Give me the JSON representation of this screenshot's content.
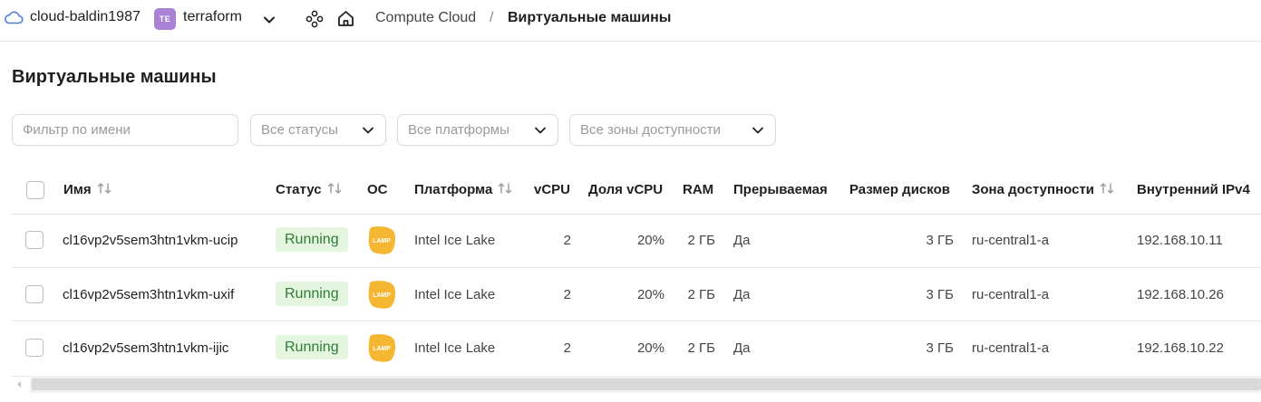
{
  "topbar": {
    "cloud_name": "cloud-baldin1987",
    "folder_badge": "TE",
    "folder_name": "terraform",
    "breadcrumb_service": "Compute Cloud",
    "breadcrumb_sep": "/",
    "breadcrumb_current": "Виртуальные машины",
    "accent_color": "#4a7fe0",
    "folder_badge_color": "#a982d6",
    "icons": [
      "cloud-icon",
      "chevron-down-icon",
      "services-icon",
      "home-icon"
    ]
  },
  "page": {
    "title": "Виртуальные машины"
  },
  "filters": {
    "name_placeholder": "Фильтр по имени",
    "status": "Все статусы",
    "platform": "Все платформы",
    "zone": "Все зоны доступности"
  },
  "table": {
    "columns": {
      "name": "Имя",
      "status": "Статус",
      "os": "ОС",
      "platform": "Платформа",
      "vcpu": "vCPU",
      "vcpu_share": "Доля vCPU",
      "ram": "RAM",
      "preemptible": "Прерываемая",
      "disk_size": "Размер дисков",
      "zone": "Зона доступности",
      "ipv4": "Внутренний IPv4"
    },
    "rows": [
      {
        "name": "cl16vp2v5sem3htn1vkm-ucip",
        "status": "Running",
        "os": "LAMP",
        "platform": "Intel Ice Lake",
        "vcpu": "2",
        "vcpu_share": "20%",
        "ram": "2 ГБ",
        "preemptible": "Да",
        "disk_size": "3 ГБ",
        "zone": "ru-central1-a",
        "ipv4": "192.168.10.11"
      },
      {
        "name": "cl16vp2v5sem3htn1vkm-uxif",
        "status": "Running",
        "os": "LAMP",
        "platform": "Intel Ice Lake",
        "vcpu": "2",
        "vcpu_share": "20%",
        "ram": "2 ГБ",
        "preemptible": "Да",
        "disk_size": "3 ГБ",
        "zone": "ru-central1-a",
        "ipv4": "192.168.10.26"
      },
      {
        "name": "cl16vp2v5sem3htn1vkm-ijic",
        "status": "Running",
        "os": "LAMP",
        "platform": "Intel Ice Lake",
        "vcpu": "2",
        "vcpu_share": "20%",
        "ram": "2 ГБ",
        "preemptible": "Да",
        "disk_size": "3 ГБ",
        "zone": "ru-central1-a",
        "ipv4": "192.168.10.22"
      }
    ],
    "status_colors": {
      "running_bg": "#e4f5e0",
      "running_text": "#2e7d32"
    },
    "os_badge_color": "#f5b731"
  }
}
